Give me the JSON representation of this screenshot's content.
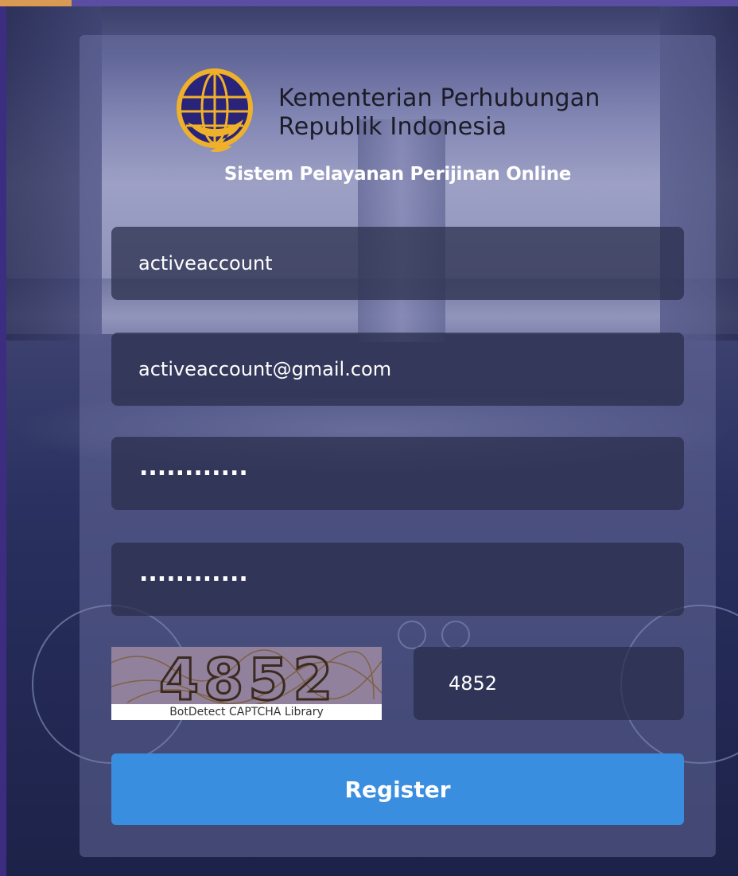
{
  "header": {
    "org_name_line1": "Kementerian Perhubungan",
    "org_name_line2": "Republik Indonesia",
    "system_title": "Sistem Pelayanan Perijinan Online"
  },
  "form": {
    "username_value": "activeaccount",
    "email_value": "activeaccount@gmail.com",
    "password_masked": "............",
    "confirm_password_masked": "............",
    "captcha_caption": "BotDetect CAPTCHA Library",
    "captcha_code_shown": "4852",
    "captcha_input_value": "4852",
    "register_label": "Register"
  },
  "colors": {
    "button": "#3a8ee0",
    "field_bg": "#282c4a",
    "logo_blue": "#2a237a",
    "logo_gold": "#f0b12a"
  }
}
